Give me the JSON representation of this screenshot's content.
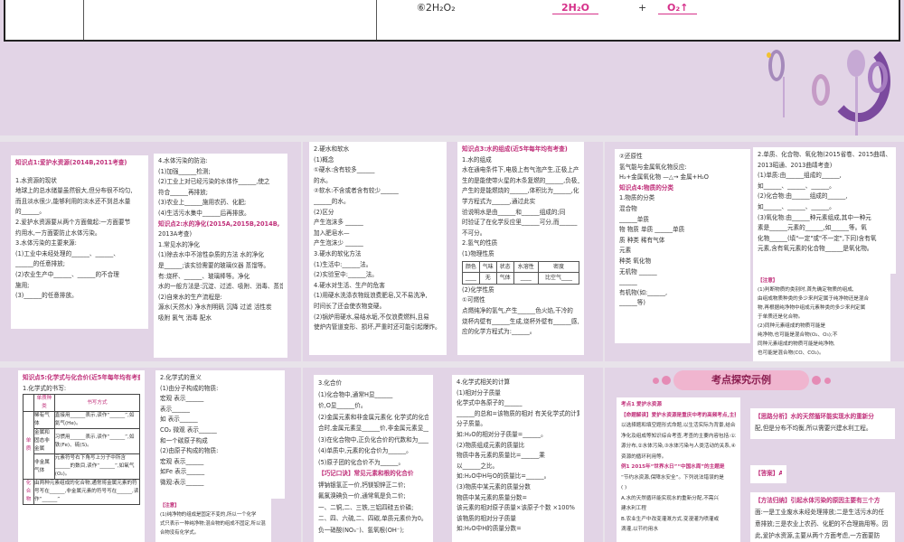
{
  "top_slide": {
    "equation_prefix": "⑥2H₂O₂",
    "product1": "2H₂O",
    "product2": "O₂↑"
  },
  "panels": {
    "s1l": [
      "知识点1:爱护水资源(2014B,2011考查)",
      "",
      "1.水资源的现状",
      "地球上的总水储量虽然很大,但分布很不均匀,",
      "而且淡水很少,能够利用的淡水还不到总水量",
      "的______。",
      "2.爱护水资源要从两个方面做起:一方面要节",
      "约用水,一方面要防止水体污染。",
      "3.水体污染的主要来源:",
      "(1)工业中未经处理的______、______、",
      "______的任意排放;",
      "(2)农业生产中______、______的不合理",
      "施用;",
      "(3)______的任意排放。"
    ],
    "s1r": [
      "4.水体污染的防治:",
      "(1)加强______检测;",
      "(2)工业上对已经污染的水体作______,使之",
      "符合______再排放;",
      "(3)农业上______施用农药、化肥;",
      "(4)生活污水集中______后再排放。",
      "知识点2:水的净化(2015A,2015B,2014B,",
      "2013A考查)",
      "1.常见水的净化",
      "(1)除去水中不溶性杂质的方法    水的净化",
      "是______;该实验需要的玻璃仪器  蒸馏等。",
      "有:烧杯、______、玻璃棒等。净化",
      "水的一般方法是:沉淀、过滤、吸附、消毒、蒸馏等。",
      "(2)自来水的生产流程是:",
      "源水(天然水) 净水剂明矾 沉降  过滤 活性炭",
      "吸附 氯气 消毒  配水"
    ],
    "s2l": [
      "2.硬水和软水",
      "(1)概念",
      "①硬水:含有较多______",
      "的水。",
      "②软水:不含或者含有较少______",
      "______的水。",
      "(2)区分",
      "          产生泡沫多 ______",
      "加入肥皂水—",
      "          产生泡沫少 ______",
      "3.硬水的软化方法",
      "(1)生活中:______法。",
      "(2)实验室中:______法。",
      "4.硬水对生活、生产的危害",
      "(1)用硬水洗涤衣物既浪费肥皂,又不易洗净,",
      "时间长了还会使衣物变硬。",
      "(2)锅炉用硬水,易结水垢,不仅浪费燃料,且易",
      "使炉内管道变形、损坏,严重时还可能引起爆炸。"
    ],
    "s2r": [
      "知识点3:水的组成(近5年每年均有考查)",
      "1.水的组成",
      "水在通电条件下,电极上有气泡产生,正极上产",
      "生的是能使带火星的木条复燃的______,负极上",
      "产生的是能燃烧的______,体积比为______,化",
      "学方程式为______,通过此实",
      "验说明水是由______和______组成的;同",
      "时验证了在化学反应里______可分,而______",
      "不可分。",
      "2.氢气的性质",
      "(1)物理性质"
    ],
    "s2r_table": {
      "headers": [
        "颜色",
        "气味",
        "状态",
        "水溶性",
        "密度"
      ],
      "row": [
        "____",
        "无",
        "气体",
        "____",
        "比空气____"
      ]
    },
    "s2r2": [
      "(2)化学性质",
      "①可燃性",
      "点燃纯净的氢气,产生______色火焰,干冷的",
      "烧杯内壁有______生成,烧杯外壁有______感,反",
      "应的化学方程式为:______。"
    ],
    "s3l": [
      "②还原性",
      "氢气能与金属氧化物反应:",
      "H₂+金属氧化物 —△→ 金属+H₂O",
      "知识点4:物质的分类",
      "1.物质的分类",
      "    混合物",
      "               ______单质",
      "物 物质     单质 ______单质",
      "质 种类          稀有气体",
      "        元素",
      "        种类          氧化物",
      "               无机物 ______",
      "                      ______",
      "               有机物(如:______,",
      "                      ______等)"
    ],
    "s3r": [
      "2.单质、化合物、氧化物(2015省卷、2015曲靖、",
      "2013昭通、2013曲靖考查)",
      "(1)单质:由______组成的______,",
      "如______、______、______。",
      "(2)化合物:由______组成的______,",
      "如______、______、______。",
      "(3)氧化物:由______种元素组成,其中一种元",
      "素是______元素的______,如______等。氧",
      "化物______(填\"一定\"或\"不一定\",下同)含有氧",
      "元素,含有氧元素的化合物______是氧化物。"
    ],
    "s3n": [
      "【注意】",
      "(1)判断物质的类别时,首先确定物质的组成,",
      "由组成物质种类的多少来判定属于纯净物还是混合",
      "物,再根据纯净物中组成元素种类的多少来判定属",
      "于单质还是化合物。",
      "(2)同种元素组成的物质可能是",
      "纯净物,也可能是混合物(O₂、O₃);不",
      "同种元素组成的物质可能是纯净物,",
      "也可能是混合物(CO、CO₂)。"
    ],
    "s4l": [
      "知识点5:化学式与化合价(近5年每年均有考查)",
      "1.化学式的书写:"
    ],
    "s4t": {
      "h1": "单质种类",
      "h2": "书写方式",
      "group1": "单质",
      "group2": "化合物",
      "rows": [
        [
          "稀有气体",
          "直接用______表示,读作“______”,如氦气(He)。"
        ],
        [
          "金属和固态非金属",
          "习惯用______表示,读作“______”,如铁(Fe)、硫(S)。"
        ],
        [
          "非金属气体",
          "元素符号右下角写上分子中所含______的数目,读作“______”,如氧气(O₂)。"
        ]
      ],
      "compound": "由两种元素组成的化合物,通常将金属元素的符号写在______,非金属元素的符号写在______,读作“______”"
    },
    "s4r": [
      "2.化学式的意义",
      "(1)由分子构成的物质:",
      "     宏观 表示______",
      "          表示______",
      "如        表示______",
      "CO₂  微观 表示______",
      "          和一个碳原子构成",
      "(2)由原子构成的物质:",
      "      宏观 表示______",
      "如Fe       表示______",
      "      微观:表示______"
    ],
    "s4n": [
      "【注意】",
      "(1)纯净物的组成是固定不变的,所以一个化学",
      "式只表示一种纯净物;混合物的组成不固定,所以混",
      "合物没有化学式。"
    ],
    "s5l": [
      "3.化合价",
      "(1)化合物中,通常H显______",
      "价,O显______价。",
      "(2)金属元素和非金属元素化  化学式的化合价",
      "合时,金属元素显______价,非金属元素显______价。",
      "(3)在化合物中,正负化合价的代数和为______。",
      "(4)单质中,元素的化合价为______。",
      "(5)原子团的化合价不为______。",
      "【巧记口诀】常见元素和根的化合价",
      "钾钠银氢正一价,钙镁钡锌正二价;",
      "氟氯溴碘负一价,通常氧是负二价;",
      "一、二铜,二、三铁,三铝四硅五价磷;",
      "二、四、六硫,二、四碳,单质元素价为0。",
      "负一硝酸(NO₃⁻)、氢氧根(OH⁻);"
    ],
    "s5r": [
      "4.化学式相关的计算",
      "(1)相对分子质量",
      "化学式中各原子的______",
      "______的总和=该物质的相对  有关化学式的计算",
      "分子质量。",
      "如:H₂O的相对分子质量=______。",
      "(2)物质组成元素的质量比",
      "物质中各元素的质量比=______乘",
      "以______之比。",
      "如:H₂O中H与O的质量比=______。",
      "(3)物质中某元素的质量分数",
      "物质中某元素的质量分数=",
      "该元素的相对原子质量×该原子个数 ×100%",
      "    该物质的相对分子质量",
      "如:H₂O中H的质量分数="
    ],
    "s6_banner": "考点探究示例",
    "s6l": [
      "考点1 爱护水资源",
      "【命题解读】爱护水资源是重庆中考的高频考点,主要",
      "以选择题和填空题形式命题,以生活实际为背景,结合水的",
      "净化及组成等知识综合考查,考查的主要内容包括:①水资",
      "源分布,②水体污染,③水体污染与人类活动的关系,④水",
      "资源的循环利用等。",
      "例1 2015年“世界水日”“中国水周”的主题是",
      "“节约水资源,保障水安全”。下列说法错误的是",
      "                                    (  )",
      "A.水的天然循环能实现水的重新分配,不需兴",
      "建水利工程",
      "B.农业生产中改变灌溉方式,变漫灌为喷灌或",
      "滴灌,以节约用水"
    ],
    "s6r1": [
      "【思路分析】水的天然循环能实现水的重新分",
      "配,但是分布不均衡,所以需要兴建水利工程。"
    ],
    "s6r2": [
      "【答案】A"
    ],
    "s6r3": [
      "【方法归纳】引起水体污染的原因主要有三个方",
      "面:一是工业废水未经处理排放;二是生活污水的任",
      "意排放;三是农业上农药、化肥的不合理施用等。因",
      "此,爱护水资源,主要从两个方面考虑,一方面要防"
    ]
  },
  "colors": {
    "slide_bg": "#e2d4e6",
    "accent_pink": "#d6308a",
    "deco_purple": "#7b4a9e"
  }
}
